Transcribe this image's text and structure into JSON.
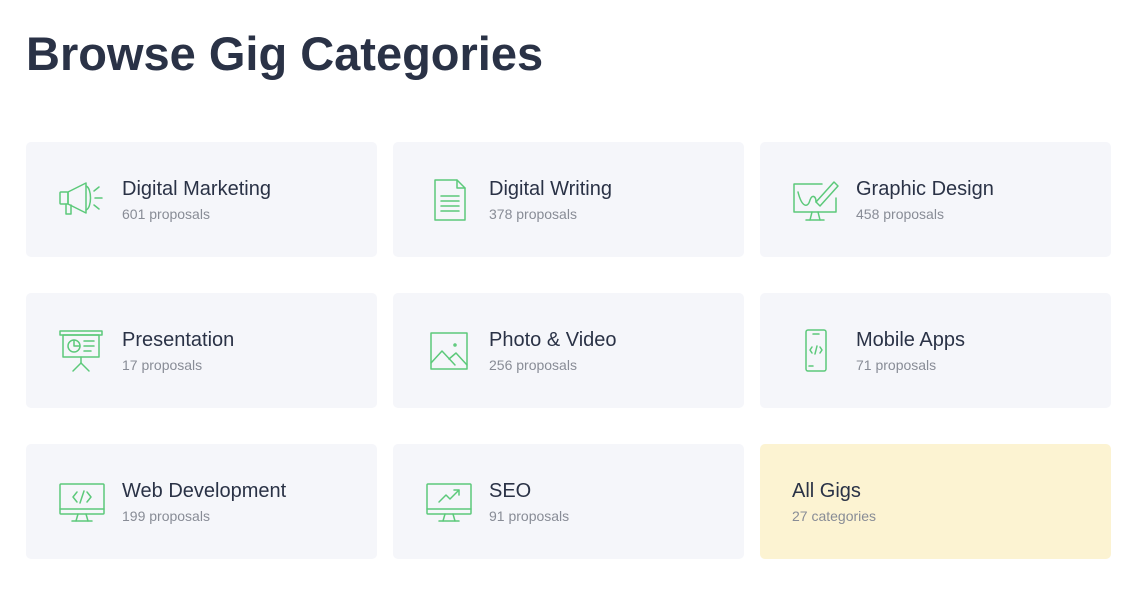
{
  "page": {
    "title": "Browse Gig Categories"
  },
  "colors": {
    "accent": "#5cc97a",
    "title_text": "#2a3246",
    "card_bg": "#f5f6fa",
    "highlight_bg": "#fcf3d2"
  },
  "categories": [
    {
      "title": "Digital Marketing",
      "sub": "601 proposals",
      "icon": "megaphone-icon"
    },
    {
      "title": "Digital Writing",
      "sub": "378 proposals",
      "icon": "document-icon"
    },
    {
      "title": "Graphic Design",
      "sub": "458 proposals",
      "icon": "monitor-pen-icon"
    },
    {
      "title": "Presentation",
      "sub": "17 proposals",
      "icon": "presentation-board-icon"
    },
    {
      "title": "Photo & Video",
      "sub": "256 proposals",
      "icon": "image-icon"
    },
    {
      "title": "Mobile Apps",
      "sub": "71 proposals",
      "icon": "mobile-code-icon"
    },
    {
      "title": "Web Development",
      "sub": "199 proposals",
      "icon": "monitor-code-icon"
    },
    {
      "title": "SEO",
      "sub": "91 proposals",
      "icon": "monitor-chart-icon"
    }
  ],
  "all_gigs": {
    "title": "All Gigs",
    "sub": "27 categories"
  }
}
